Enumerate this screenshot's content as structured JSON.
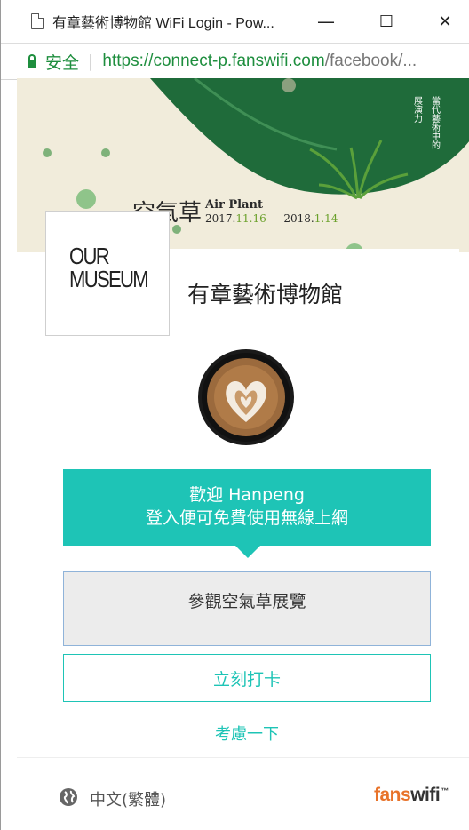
{
  "window": {
    "title": "有章藝術博物館 WiFi Login - Pow...",
    "min_glyph": "—",
    "max_glyph": "☐",
    "close_glyph": "✕"
  },
  "address": {
    "secure_label": "安全",
    "url_host": "https://connect-p.fanswifi.com",
    "url_rest": "/facebook/..."
  },
  "hero": {
    "exhibit_title": "空氣草",
    "exhibit_en": "Air Plant",
    "date_start_a": "2017.",
    "date_start_b": "11.16",
    "date_sep": " — ",
    "date_end_a": "2018.",
    "date_end_b": "1.14",
    "vertical_1": "當代藝術中的",
    "vertical_2": "展演力"
  },
  "museum": {
    "logo_line1": "OUR",
    "logo_line2": "MUSEUM",
    "name": "有章藝術博物館"
  },
  "welcome": {
    "line1": "歡迎 Hanpeng",
    "line2": "登入便可免費使用無線上網"
  },
  "message": {
    "value": "參觀空氣草展覽"
  },
  "actions": {
    "checkin_label": "立刻打卡",
    "later_label": "考慮一下"
  },
  "footer": {
    "language": "中文(繁體)",
    "brand_a": "fans",
    "brand_b": "wifi",
    "brand_tm": "™"
  },
  "colors": {
    "accent": "#1ec4b6",
    "hero_bg": "#f1ecdb",
    "hero_green": "#1f6b3a",
    "secure_green": "#1e8e3e",
    "brand_orange": "#e8732a"
  }
}
